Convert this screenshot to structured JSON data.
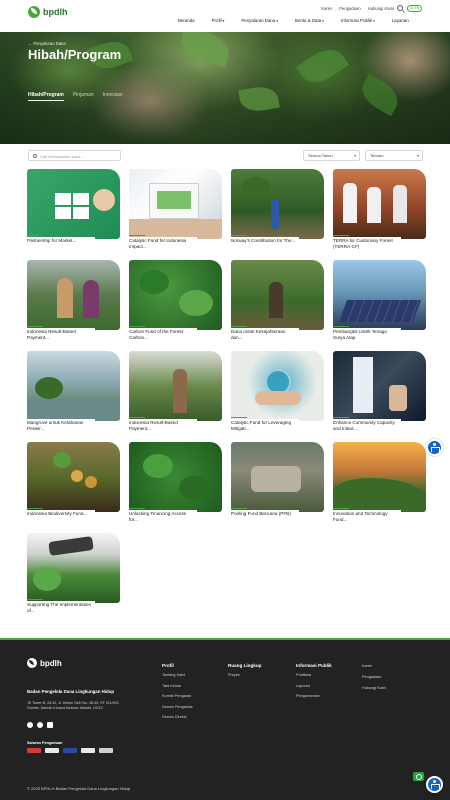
{
  "brand": {
    "name": "bpdlh",
    "tagline": ""
  },
  "util_links": [
    "Karier",
    "Pengadaan",
    "Hubungi Kami"
  ],
  "lang_toggle": "ID EN",
  "nav": [
    {
      "label": "Beranda",
      "has_menu": false
    },
    {
      "label": "Profil",
      "has_menu": true
    },
    {
      "label": "Penyaluran Dana",
      "has_menu": true
    },
    {
      "label": "Berita & Data",
      "has_menu": true
    },
    {
      "label": "Informasi Publik",
      "has_menu": true
    },
    {
      "label": "Layanan",
      "has_menu": false
    }
  ],
  "hero": {
    "breadcrumb": "← Penyaluran Dana",
    "title": "Hibah/Program",
    "tabs": [
      "Hibah/Program",
      "Pinjaman",
      "Investasi"
    ],
    "active_tab": "Hibah/Program"
  },
  "filters": {
    "search_placeholder": "Cari berdasarkan judul...",
    "year_label": "Semua Tahun",
    "sort_label": "Terbaru"
  },
  "cards": [
    {
      "title": "Partnership for Market..."
    },
    {
      "title": "Catalytic Fund for Indonesia Impact..."
    },
    {
      "title": "Norway's Contribution for The ..."
    },
    {
      "title": "TERRA for Customary Forest (TERRA-CF)"
    },
    {
      "title": "Indonesia Result-Based Payment..."
    },
    {
      "title": "Carbon Fund of the Forest Carbon..."
    },
    {
      "title": "Dana untuk Kesejahteraan dan..."
    },
    {
      "title": "Pembangkit Listrik Tenaga Surya Atap"
    },
    {
      "title": "Mangrove untuk Ketahanan Pesisir..."
    },
    {
      "title": "Indonesia Result-Based Payment..."
    },
    {
      "title": "Catalytic Fund for Leveraging Mitigati..."
    },
    {
      "title": "Enhance Community Capacity and Initiat..."
    },
    {
      "title": "Indonesia Biodiversity Fund..."
    },
    {
      "title": "Unlocking Financing Access for..."
    },
    {
      "title": "Pooling Fund Bencana (PFB)"
    },
    {
      "title": "Innovation and Technology Fund..."
    },
    {
      "title": "Supporting The Implementation of..."
    }
  ],
  "footer": {
    "org_name": "Badan Pengelola Dana Lingkungan Hidup",
    "address": "JS Tower B, 28-30, Jl. Kebon Sirih No. 48-50, RT 011/002, Gambir, Daerah Khusus Ibukota Jakarta, 10110",
    "partners_title": "Saluran Pengaduan",
    "columns": [
      {
        "title": "Profil",
        "items": [
          "Tentang Kami",
          "Tata Kelola",
          "Komite Pengarah",
          "Dewan Pengawas",
          "Dewan Direksi"
        ]
      },
      {
        "title": "Ruang Lingkup",
        "items": [
          "Proyek"
        ]
      },
      {
        "title": "Informasi Publik",
        "items": [
          "Publikasi",
          "Laporan",
          "Pengumuman"
        ]
      }
    ],
    "extra_links": [
      "Karier",
      "Pengadaan",
      "Hubungi Kami"
    ],
    "copyright": "© 2025 BPDLH-Badan Pengelola Dana Lingkungan Hidup"
  },
  "colors": {
    "accent": "#4aa83a",
    "footer_bg": "#222222",
    "access_blue": "#1463c8"
  }
}
